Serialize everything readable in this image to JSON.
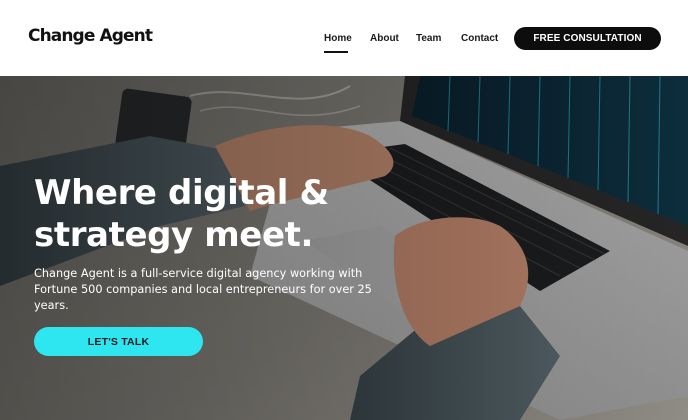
{
  "header": {
    "logo_text": "Change Agent",
    "nav": {
      "home": "Home",
      "about": "About",
      "team": "Team",
      "contact": "Contact"
    },
    "cta_label": "FREE CONSULTATION"
  },
  "hero": {
    "title_line1": "Where digital &",
    "title_line2": "strategy meet.",
    "description": "Change Agent is a full-service digital agency working with Fortune 500 companies and local entrepreneurs for over 25 years.",
    "button_label": "LET'S TALK"
  },
  "colors": {
    "accent": "#2de6f0",
    "dark_button": "#0d0d0d",
    "header_bg": "#ffffff"
  }
}
